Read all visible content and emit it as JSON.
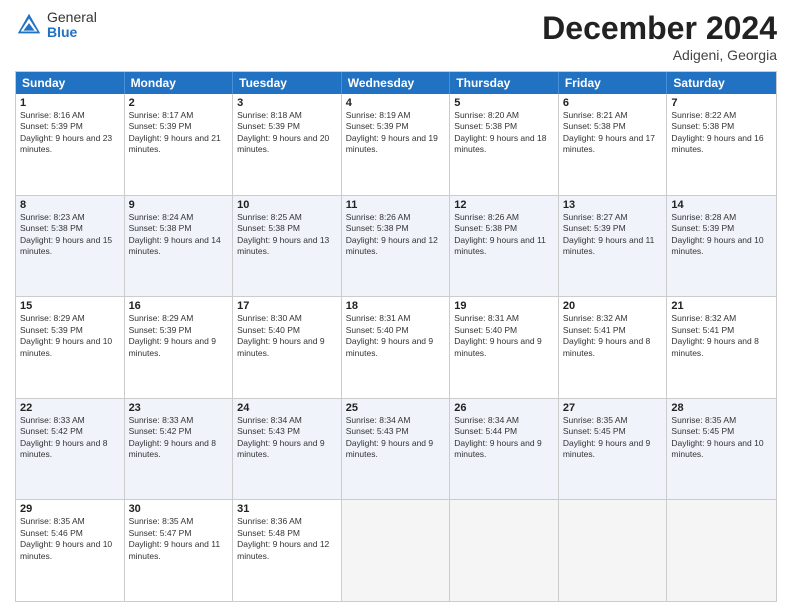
{
  "header": {
    "logo_general": "General",
    "logo_blue": "Blue",
    "month_title": "December 2024",
    "location": "Adigeni, Georgia"
  },
  "day_headers": [
    "Sunday",
    "Monday",
    "Tuesday",
    "Wednesday",
    "Thursday",
    "Friday",
    "Saturday"
  ],
  "weeks": [
    {
      "alt": false,
      "days": [
        {
          "num": "1",
          "sunrise": "8:16 AM",
          "sunset": "5:39 PM",
          "daylight": "9 hours and 23 minutes"
        },
        {
          "num": "2",
          "sunrise": "8:17 AM",
          "sunset": "5:39 PM",
          "daylight": "9 hours and 21 minutes"
        },
        {
          "num": "3",
          "sunrise": "8:18 AM",
          "sunset": "5:39 PM",
          "daylight": "9 hours and 20 minutes"
        },
        {
          "num": "4",
          "sunrise": "8:19 AM",
          "sunset": "5:39 PM",
          "daylight": "9 hours and 19 minutes"
        },
        {
          "num": "5",
          "sunrise": "8:20 AM",
          "sunset": "5:38 PM",
          "daylight": "9 hours and 18 minutes"
        },
        {
          "num": "6",
          "sunrise": "8:21 AM",
          "sunset": "5:38 PM",
          "daylight": "9 hours and 17 minutes"
        },
        {
          "num": "7",
          "sunrise": "8:22 AM",
          "sunset": "5:38 PM",
          "daylight": "9 hours and 16 minutes"
        }
      ]
    },
    {
      "alt": true,
      "days": [
        {
          "num": "8",
          "sunrise": "8:23 AM",
          "sunset": "5:38 PM",
          "daylight": "9 hours and 15 minutes"
        },
        {
          "num": "9",
          "sunrise": "8:24 AM",
          "sunset": "5:38 PM",
          "daylight": "9 hours and 14 minutes"
        },
        {
          "num": "10",
          "sunrise": "8:25 AM",
          "sunset": "5:38 PM",
          "daylight": "9 hours and 13 minutes"
        },
        {
          "num": "11",
          "sunrise": "8:26 AM",
          "sunset": "5:38 PM",
          "daylight": "9 hours and 12 minutes"
        },
        {
          "num": "12",
          "sunrise": "8:26 AM",
          "sunset": "5:38 PM",
          "daylight": "9 hours and 11 minutes"
        },
        {
          "num": "13",
          "sunrise": "8:27 AM",
          "sunset": "5:39 PM",
          "daylight": "9 hours and 11 minutes"
        },
        {
          "num": "14",
          "sunrise": "8:28 AM",
          "sunset": "5:39 PM",
          "daylight": "9 hours and 10 minutes"
        }
      ]
    },
    {
      "alt": false,
      "days": [
        {
          "num": "15",
          "sunrise": "8:29 AM",
          "sunset": "5:39 PM",
          "daylight": "9 hours and 10 minutes"
        },
        {
          "num": "16",
          "sunrise": "8:29 AM",
          "sunset": "5:39 PM",
          "daylight": "9 hours and 9 minutes"
        },
        {
          "num": "17",
          "sunrise": "8:30 AM",
          "sunset": "5:40 PM",
          "daylight": "9 hours and 9 minutes"
        },
        {
          "num": "18",
          "sunrise": "8:31 AM",
          "sunset": "5:40 PM",
          "daylight": "9 hours and 9 minutes"
        },
        {
          "num": "19",
          "sunrise": "8:31 AM",
          "sunset": "5:40 PM",
          "daylight": "9 hours and 9 minutes"
        },
        {
          "num": "20",
          "sunrise": "8:32 AM",
          "sunset": "5:41 PM",
          "daylight": "9 hours and 8 minutes"
        },
        {
          "num": "21",
          "sunrise": "8:32 AM",
          "sunset": "5:41 PM",
          "daylight": "9 hours and 8 minutes"
        }
      ]
    },
    {
      "alt": true,
      "days": [
        {
          "num": "22",
          "sunrise": "8:33 AM",
          "sunset": "5:42 PM",
          "daylight": "9 hours and 8 minutes"
        },
        {
          "num": "23",
          "sunrise": "8:33 AM",
          "sunset": "5:42 PM",
          "daylight": "9 hours and 8 minutes"
        },
        {
          "num": "24",
          "sunrise": "8:34 AM",
          "sunset": "5:43 PM",
          "daylight": "9 hours and 9 minutes"
        },
        {
          "num": "25",
          "sunrise": "8:34 AM",
          "sunset": "5:43 PM",
          "daylight": "9 hours and 9 minutes"
        },
        {
          "num": "26",
          "sunrise": "8:34 AM",
          "sunset": "5:44 PM",
          "daylight": "9 hours and 9 minutes"
        },
        {
          "num": "27",
          "sunrise": "8:35 AM",
          "sunset": "5:45 PM",
          "daylight": "9 hours and 9 minutes"
        },
        {
          "num": "28",
          "sunrise": "8:35 AM",
          "sunset": "5:45 PM",
          "daylight": "9 hours and 10 minutes"
        }
      ]
    },
    {
      "alt": false,
      "days": [
        {
          "num": "29",
          "sunrise": "8:35 AM",
          "sunset": "5:46 PM",
          "daylight": "9 hours and 10 minutes"
        },
        {
          "num": "30",
          "sunrise": "8:35 AM",
          "sunset": "5:47 PM",
          "daylight": "9 hours and 11 minutes"
        },
        {
          "num": "31",
          "sunrise": "8:36 AM",
          "sunset": "5:48 PM",
          "daylight": "9 hours and 12 minutes"
        },
        {
          "num": "",
          "sunrise": "",
          "sunset": "",
          "daylight": ""
        },
        {
          "num": "",
          "sunrise": "",
          "sunset": "",
          "daylight": ""
        },
        {
          "num": "",
          "sunrise": "",
          "sunset": "",
          "daylight": ""
        },
        {
          "num": "",
          "sunrise": "",
          "sunset": "",
          "daylight": ""
        }
      ]
    }
  ],
  "labels": {
    "sunrise": "Sunrise:",
    "sunset": "Sunset:",
    "daylight": "Daylight:"
  }
}
